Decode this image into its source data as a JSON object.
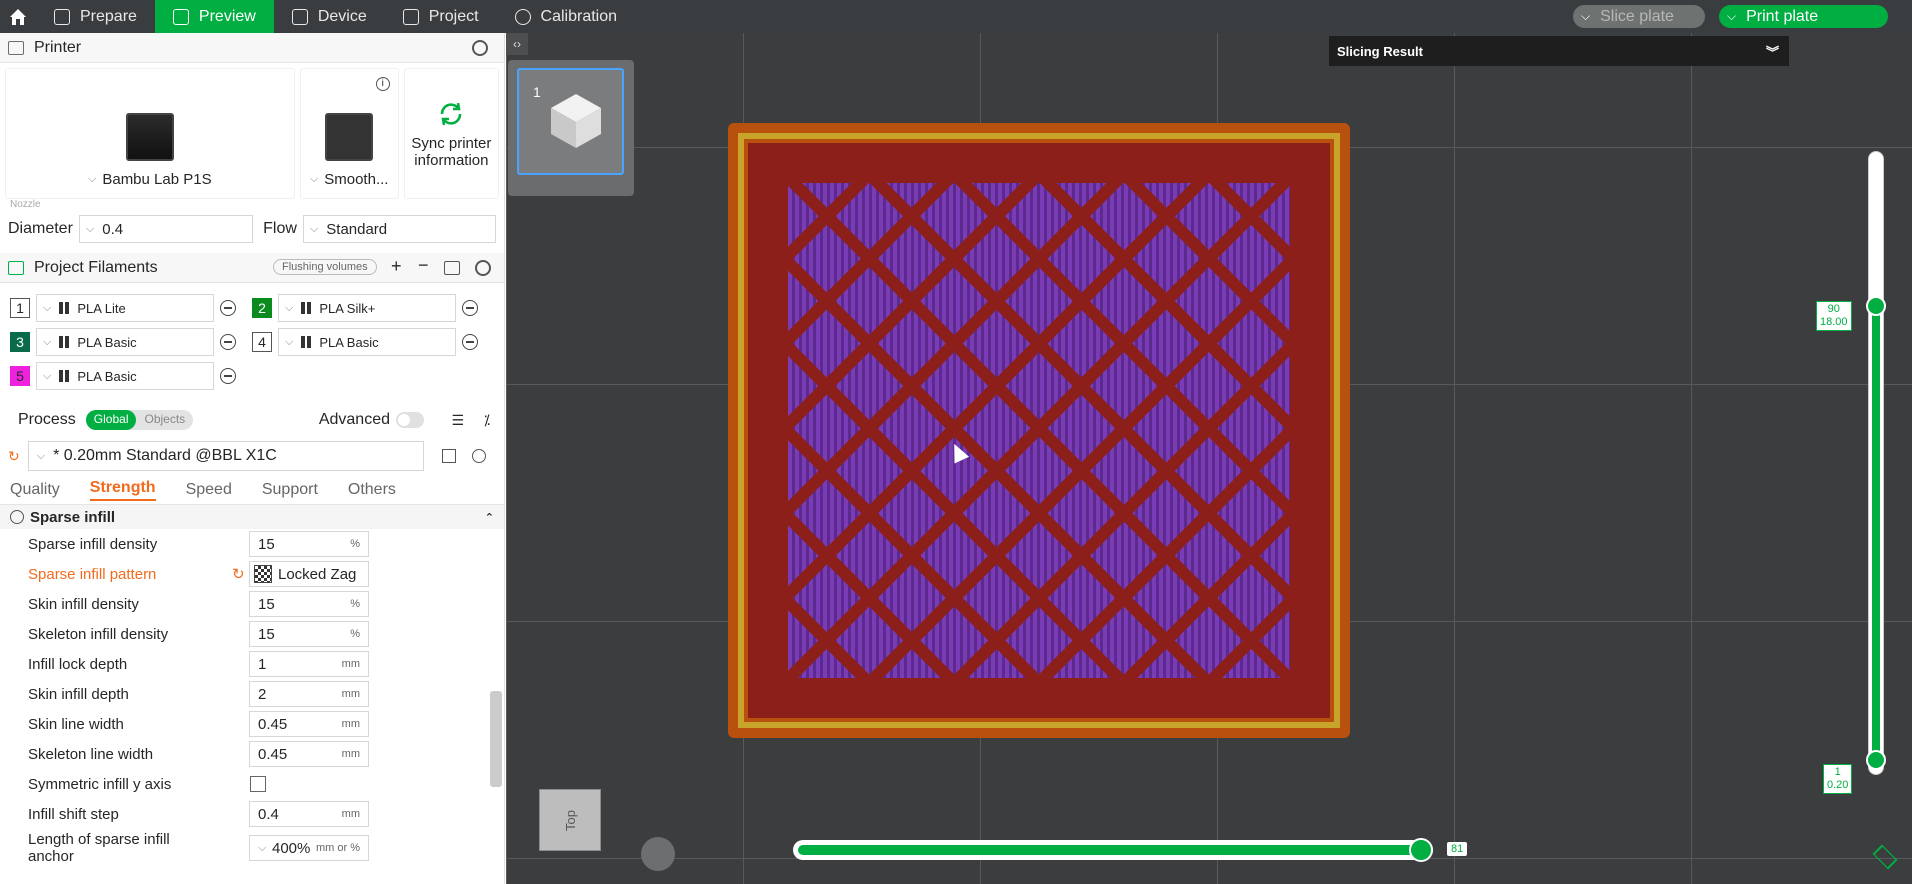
{
  "topbar": {
    "tabs": [
      "Prepare",
      "Preview",
      "Device",
      "Project",
      "Calibration"
    ],
    "slice_plate": "Slice plate",
    "print_plate": "Print plate"
  },
  "printer": {
    "title": "Printer",
    "printer_name": "Bambu Lab P1S",
    "plate_name": "Smooth...",
    "sync": "Sync printer information",
    "nozzle_label": "Nozzle",
    "diameter_label": "Diameter",
    "diameter_value": "0.4",
    "flow_label": "Flow",
    "flow_value": "Standard"
  },
  "filaments": {
    "title": "Project Filaments",
    "flushing": "Flushing volumes",
    "items": [
      {
        "num": "1",
        "name": "PLA Lite",
        "color": "#ffffff"
      },
      {
        "num": "2",
        "name": "PLA Silk+",
        "color": "#0b8a1e"
      },
      {
        "num": "3",
        "name": "PLA Basic",
        "color": "#0a6b4a"
      },
      {
        "num": "4",
        "name": "PLA Basic",
        "color": "#ffffff"
      },
      {
        "num": "5",
        "name": "PLA Basic",
        "color": "#ee22dd"
      }
    ]
  },
  "process": {
    "title": "Process",
    "global": "Global",
    "objects": "Objects",
    "advanced": "Advanced",
    "preset": "* 0.20mm Standard @BBL X1C",
    "tabs": [
      "Quality",
      "Strength",
      "Speed",
      "Support",
      "Others"
    ],
    "section": "Sparse infill",
    "params": [
      {
        "label": "Sparse infill density",
        "value": "15",
        "unit": "%"
      },
      {
        "label": "Sparse infill pattern",
        "value": "Locked Zag",
        "unit": ""
      },
      {
        "label": "Skin infill density",
        "value": "15",
        "unit": "%"
      },
      {
        "label": "Skeleton infill density",
        "value": "15",
        "unit": "%"
      },
      {
        "label": "Infill lock depth",
        "value": "1",
        "unit": "mm"
      },
      {
        "label": "Skin infill depth",
        "value": "2",
        "unit": "mm"
      },
      {
        "label": "Skin line width",
        "value": "0.45",
        "unit": "mm"
      },
      {
        "label": "Skeleton line width",
        "value": "0.45",
        "unit": "mm"
      },
      {
        "label": "Symmetric infill y axis",
        "value": "",
        "unit": ""
      },
      {
        "label": "Infill shift step",
        "value": "0.4",
        "unit": "mm"
      },
      {
        "label": "Length of sparse infill anchor",
        "value": "400%",
        "unit": "mm or %"
      }
    ]
  },
  "viewport": {
    "plate_number": "1",
    "slicing_result": "Slicing Result",
    "top_label": "Top",
    "layer_top": "90",
    "height_top": "18.00",
    "layer_bottom": "1",
    "height_bottom": "0.20",
    "move_value": "81"
  }
}
